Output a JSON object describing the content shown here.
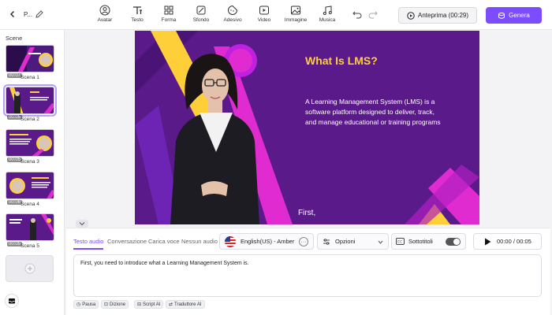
{
  "header": {
    "project_name": "P...",
    "tools": [
      {
        "label": "Avatar",
        "icon": "avatar-icon"
      },
      {
        "label": "Testo",
        "icon": "text-icon"
      },
      {
        "label": "Forma",
        "icon": "shape-icon"
      },
      {
        "label": "Sfondo",
        "icon": "background-icon"
      },
      {
        "label": "Adesivo",
        "icon": "sticker-icon"
      },
      {
        "label": "Video",
        "icon": "video-icon"
      },
      {
        "label": "Immagine",
        "icon": "image-icon"
      },
      {
        "label": "Musica",
        "icon": "music-icon"
      }
    ],
    "preview_label": "Anteprima (00:29)",
    "generate_label": "Genera"
  },
  "scenes": {
    "title": "Scene",
    "items": [
      {
        "label": "Scena 1",
        "duration": "00:07",
        "active": false
      },
      {
        "label": "Scena 2",
        "duration": "00:05",
        "active": true
      },
      {
        "label": "Scena 3",
        "duration": "00:05",
        "active": false
      },
      {
        "label": "Scena 4",
        "duration": "00:06",
        "active": false
      },
      {
        "label": "Scena 5",
        "duration": "00:05",
        "active": false
      }
    ]
  },
  "slide": {
    "title": "What Is LMS?",
    "body": "A Learning Management System (LMS) is a software platform designed to deliver, track, and manage educational or training programs",
    "subtitle": "First,"
  },
  "bottom": {
    "tabs": [
      "Testo audio",
      "Conversazione",
      "Carica voce",
      "Nessun audio"
    ],
    "voice": "English(US) - Amber",
    "options": "Opzioni",
    "subtitles_label": "Sottotitoli",
    "subtitles_on": true,
    "time": "00:00 / 00:05",
    "script": "First, you need to introduce what a Learning Management System is.",
    "chips": [
      "Pausa",
      "Dizione",
      "Script AI",
      "Traduttore AI"
    ]
  },
  "colors": {
    "accent": "#7c4dff",
    "slide_bg": "#5a1a8a",
    "title_yellow": "#ffcf3a",
    "magenta": "#e02bd0"
  }
}
